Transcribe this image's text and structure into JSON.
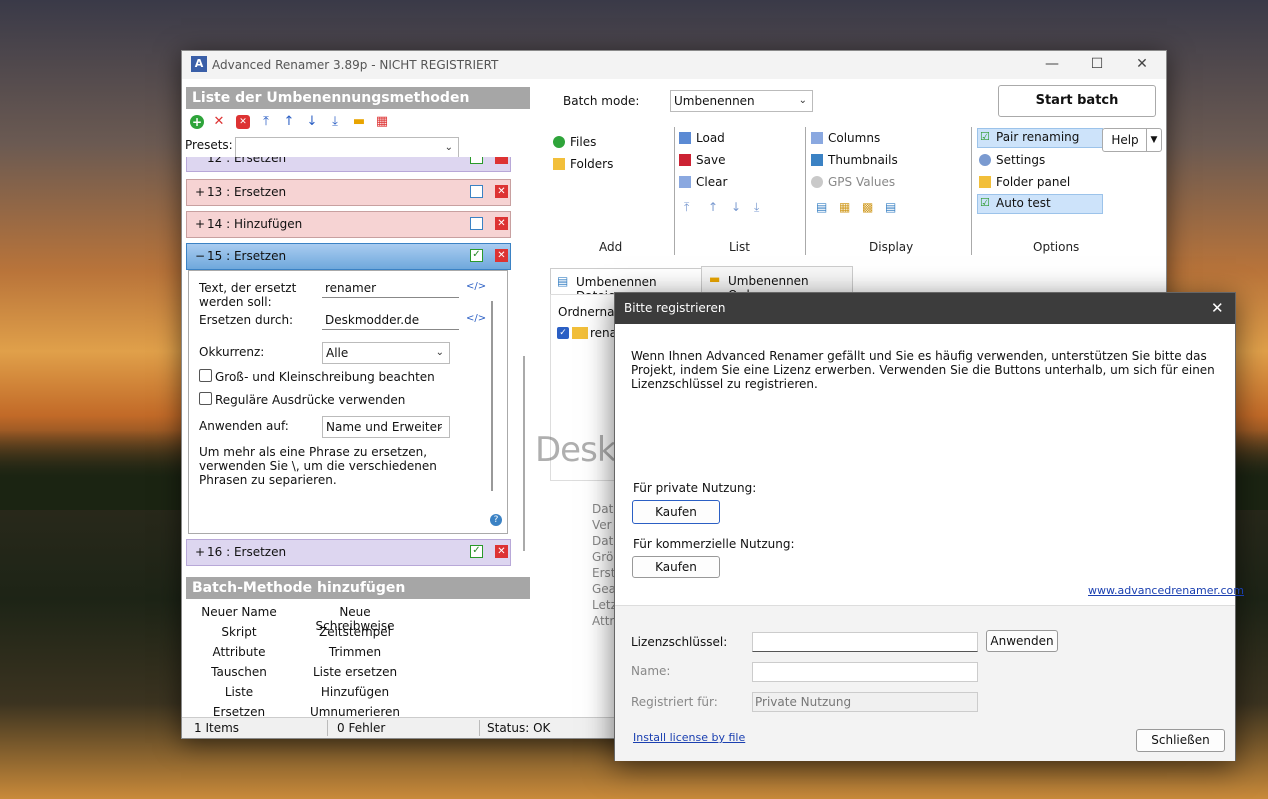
{
  "window": {
    "title": "Advanced Renamer 3.89p - NICHT REGISTRIERT",
    "logo": "A"
  },
  "left": {
    "section_title": "Liste der Umbenennungsmethoden",
    "presets_label": "Presets:",
    "presets_value": "",
    "partial_method": "12 : Ersetzen",
    "methods": [
      {
        "label": "13 : Ersetzen",
        "toggle": "+"
      },
      {
        "label": "14 : Hinzufügen",
        "toggle": "+"
      },
      {
        "label": "15 : Ersetzen",
        "toggle": "−"
      },
      {
        "label": "16 : Ersetzen",
        "toggle": "+"
      }
    ],
    "form": {
      "text_label": "Text, der ersetzt werden soll:",
      "text_value": "renamer",
      "replace_label": "Ersetzen durch:",
      "replace_value": "Deskmodder.de",
      "occurrence_label": "Okkurrenz:",
      "occurrence_value": "Alle",
      "case_label": "Groß- und Kleinschreibung beachten",
      "regex_label": "Reguläre Ausdrücke verwenden",
      "apply_label": "Anwenden auf:",
      "apply_value": "Name und Erweiter",
      "hint": "Um mehr als eine Phrase zu ersetzen, verwenden Sie \\, um die verschiedenen Phrasen zu separieren.",
      "code_icon": "</>",
      "help_icon": "?"
    },
    "batch_title": "Batch-Methode hinzufügen",
    "batch_methods": [
      "Neuer Name",
      "Neue Schreibweise",
      "Skript",
      "Zeitstempel",
      "Attribute",
      "Trimmen",
      "Tauschen",
      "Liste ersetzen",
      "Liste",
      "Hinzufügen",
      "Ersetzen",
      "Umnumerieren"
    ]
  },
  "ribbon": {
    "batch_mode_label": "Batch mode:",
    "batch_mode_value": "Umbenennen",
    "start_batch": "Start batch",
    "add": {
      "files": "Files",
      "folders": "Folders",
      "label": "Add"
    },
    "list": {
      "load": "Load",
      "save": "Save",
      "clear": "Clear",
      "label": "List"
    },
    "display": {
      "columns": "Columns",
      "thumbnails": "Thumbnails",
      "gps": "GPS Values",
      "label": "Display"
    },
    "options": {
      "pair": "Pair renaming",
      "settings": "Settings",
      "folder_panel": "Folder panel",
      "auto_test": "Auto test",
      "label": "Options",
      "help": "Help"
    }
  },
  "tabs": [
    "Umbenennen Dateien",
    "Umbenennen Ordner"
  ],
  "table": {
    "header": "Ordnernam",
    "row": "renam"
  },
  "info_labels": [
    "Dat",
    "Ver",
    "Dat",
    "Grö",
    "Erst",
    "Gea",
    "Letz",
    "Attr"
  ],
  "watermark": "Deskmodder.de",
  "status": {
    "items": "1 Items",
    "errors": "0 Fehler",
    "status": "Status: OK"
  },
  "dialog": {
    "title": "Bitte registrieren",
    "message": "Wenn Ihnen Advanced Renamer gefällt und Sie es häufig verwenden, unterstützen Sie bitte das Projekt, indem Sie eine Lizenz erwerben. Verwenden Sie die Buttons unterhalb, um sich für einen Lizenzschlüssel zu registrieren.",
    "private_label": "Für private Nutzung:",
    "commercial_label": "Für kommerzielle Nutzung:",
    "buy": "Kaufen",
    "website": "www.advancedrenamer.com",
    "license_label": "Lizenzschlüssel:",
    "license_value": "",
    "apply": "Anwenden",
    "name_label": "Name:",
    "name_value": "",
    "registered_label": "Registriert für:",
    "registered_value": "Private Nutzung",
    "install_link": "Install license by file",
    "close": "Schließen"
  },
  "colors": {
    "accent": "#3b82c4",
    "method_red": "#f6d3d3",
    "method_purple": "#ddd6f0",
    "method_active": "#6fa8dc"
  }
}
